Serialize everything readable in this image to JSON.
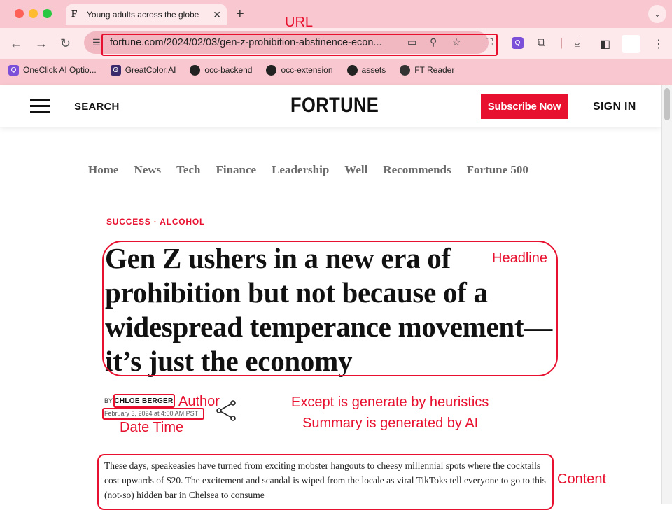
{
  "browser": {
    "tab_title": "Young adults across the globe",
    "tab_favicon": "F",
    "url": "fortune.com/2024/02/03/gen-z-prohibition-abstinence-econ...",
    "bookmarks": [
      {
        "label": "OneClick AI Optio...",
        "icon": "oneclick-icon",
        "color": "#7b4fd8"
      },
      {
        "label": "GreatColor.AI",
        "icon": "greatcolor-icon",
        "color": "#3b2a6b"
      },
      {
        "label": "occ-backend",
        "icon": "github-icon"
      },
      {
        "label": "occ-extension",
        "icon": "github-icon"
      },
      {
        "label": "assets",
        "icon": "github-icon"
      },
      {
        "label": "FT Reader",
        "icon": "ft-reader-icon"
      }
    ]
  },
  "site": {
    "search_label": "SEARCH",
    "logo": "FORTUNE",
    "subscribe_label": "Subscribe Now",
    "signin_label": "SIGN IN",
    "nav": [
      "Home",
      "News",
      "Tech",
      "Finance",
      "Leadership",
      "Well",
      "Recommends",
      "Fortune 500"
    ]
  },
  "article": {
    "kicker": "SUCCESS · ALCOHOL",
    "headline": "Gen Z ushers in a new era of prohibition but not because of a widespread temperance movement—it’s just the economy",
    "by_prefix": "BY",
    "author": "CHLOE BERGER",
    "date": "February 3, 2024 at 4:00 AM PST",
    "body": "These days, speakeasies have turned from exciting mobster hangouts to cheesy millennial spots where the cocktails cost upwards of $20. The excitement and scandal is wiped from the locale as viral TikToks tell everyone to go to this (not-so) hidden bar in Chelsea to consume"
  },
  "annotations": {
    "url": "URL",
    "headline": "Headline",
    "author": "Author",
    "datetime": "Date Time",
    "content": "Content",
    "note1": "Except is generate by heuristics",
    "note2": "Summary is generated by AI",
    "color": "#e8102f"
  }
}
